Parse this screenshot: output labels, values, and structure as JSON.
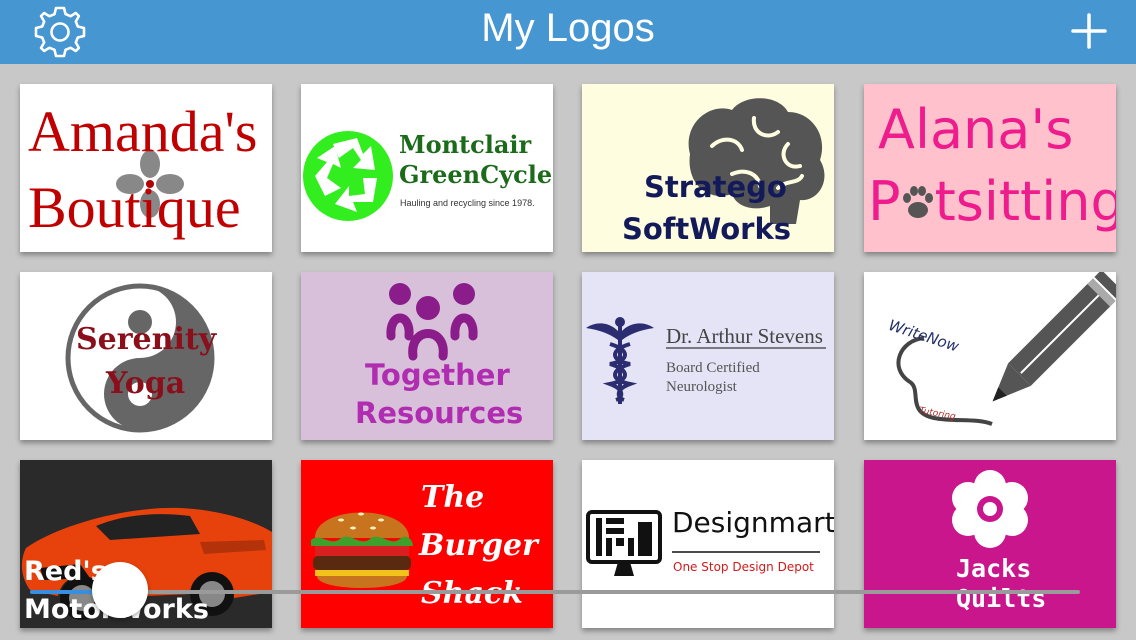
{
  "header": {
    "title": "My Logos",
    "settings_icon": "gear-icon",
    "add_icon": "plus-icon"
  },
  "logos": [
    {
      "line1": "Amanda's",
      "line2": "Boutique",
      "bg": "#ffffff",
      "icon": "flower-icon"
    },
    {
      "line1": "Montclair",
      "line2": "GreenCycle",
      "tagline": "Hauling and recycling since 1978.",
      "bg": "#ffffff",
      "icon": "recycle-icon"
    },
    {
      "line1": "Stratego",
      "line2": "SoftWorks",
      "bg": "#fffde0",
      "icon": "brain-icon"
    },
    {
      "line1": "Alana's",
      "line2": "Petsitting",
      "line2_before": "P",
      "line2_after": "tsitting",
      "bg": "#ffc2cd",
      "icon": "paw-icon"
    },
    {
      "line1": "Serenity",
      "line2": "Yoga",
      "bg": "#ffffff",
      "icon": "yin-yang-icon"
    },
    {
      "line1": "Together",
      "line2": "Resources",
      "bg": "#d9c0da",
      "icon": "people-icon"
    },
    {
      "line1": "Dr. Arthur Stevens",
      "line2": "Board Certified",
      "line3": "Neurologist",
      "bg": "#e4e4f6",
      "icon": "caduceus-icon"
    },
    {
      "line1": "WriteNow",
      "line2": "Tutoring",
      "bg": "#ffffff",
      "icon": "pencil-icon"
    },
    {
      "line1": "Red's",
      "line2": "MotorWorks",
      "bg": "#111111",
      "icon": "car-icon"
    },
    {
      "line1": "The",
      "line2": "Burger",
      "line3": "Shack",
      "bg": "#ff0000",
      "icon": "burger-icon"
    },
    {
      "line1": "Designmart",
      "line2": "One Stop Design Depot",
      "bg": "#ffffff",
      "icon": "monitor-icon"
    },
    {
      "line1": "Jacks",
      "line2": "Quilts",
      "bg": "#c9168c",
      "icon": "flower-icon"
    }
  ],
  "slider": {
    "value": 0.12,
    "fill_color": "#3a8ee0"
  }
}
